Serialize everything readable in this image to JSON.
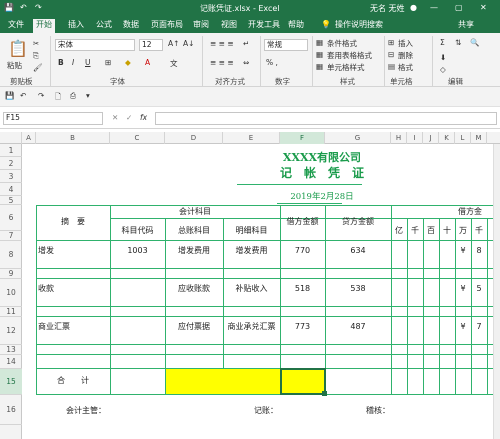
{
  "titlebar": {
    "filename": "记账凭证.xlsx - Excel",
    "user": "无名 无姓",
    "restore": "▢",
    "minimize": "—",
    "close": "✕"
  },
  "tabs": [
    "文件",
    "开始",
    "插入",
    "公式",
    "数据",
    "页面布局",
    "审阅",
    "视图",
    "开发工具",
    "帮助"
  ],
  "tell_me": "操作说明搜索",
  "share": "共享",
  "ribbon": {
    "groups": [
      "剪贴板",
      "字体",
      "对齐方式",
      "数字",
      "样式",
      "单元格",
      "编辑"
    ],
    "font_name": "宋体",
    "font_size": "12",
    "paste": "粘贴",
    "number_format": "常规",
    "conditional_format": "条件格式",
    "table_format": "套用表格格式",
    "cell_style": "单元格样式",
    "insert": "插入",
    "delete": "删除",
    "format": "格式",
    "bold": "B",
    "italic": "I",
    "underline": "U"
  },
  "name_box": "F15",
  "fx": "fx",
  "columns": [
    "A",
    "B",
    "C",
    "D",
    "E",
    "F",
    "G",
    "H",
    "I",
    "J",
    "K",
    "L",
    "M"
  ],
  "rows": [
    "1",
    "2",
    "3",
    "4",
    "5",
    "6",
    "7",
    "8",
    "9",
    "10",
    "11",
    "12",
    "13",
    "14",
    "15",
    "16"
  ],
  "voucher": {
    "company": "XXXX有限公司",
    "title": "记　帐　凭　证",
    "date": "2019年2月28日",
    "summary_header": "摘　要",
    "subject_header": "会计科目",
    "debit_header": "借方金额",
    "credit_header": "贷方金额",
    "code_header": "科目代码",
    "general_header": "总账科目",
    "detail_header": "明细科目",
    "digits": [
      "亿",
      "千",
      "百",
      "十",
      "万",
      "千"
    ],
    "right_header": "借方金",
    "rows": [
      {
        "summary": "增发",
        "code": "1003",
        "general": "增发费用",
        "detail": "增发费用",
        "debit": "770",
        "credit": "634",
        "yen": "¥",
        "digit": "8"
      },
      {
        "summary": "收款",
        "code": "",
        "general": "应收账款",
        "detail": "补贴收入",
        "debit": "518",
        "credit": "538",
        "yen": "¥",
        "digit": "5"
      },
      {
        "summary": "商业汇票",
        "code": "",
        "general": "应付票据",
        "detail": "商业承兑汇票",
        "debit": "773",
        "credit": "487",
        "yen": "¥",
        "digit": "7"
      }
    ],
    "total": "合　　计",
    "footer": {
      "supervisor": "会计主管：",
      "bookkeeper": "记账：",
      "reviewer": "稽核："
    }
  },
  "colors": {
    "excel_green": "#217346",
    "grid_green": "#2fb26d",
    "highlight": "#ffff00",
    "text_green": "#1a9b4b"
  }
}
